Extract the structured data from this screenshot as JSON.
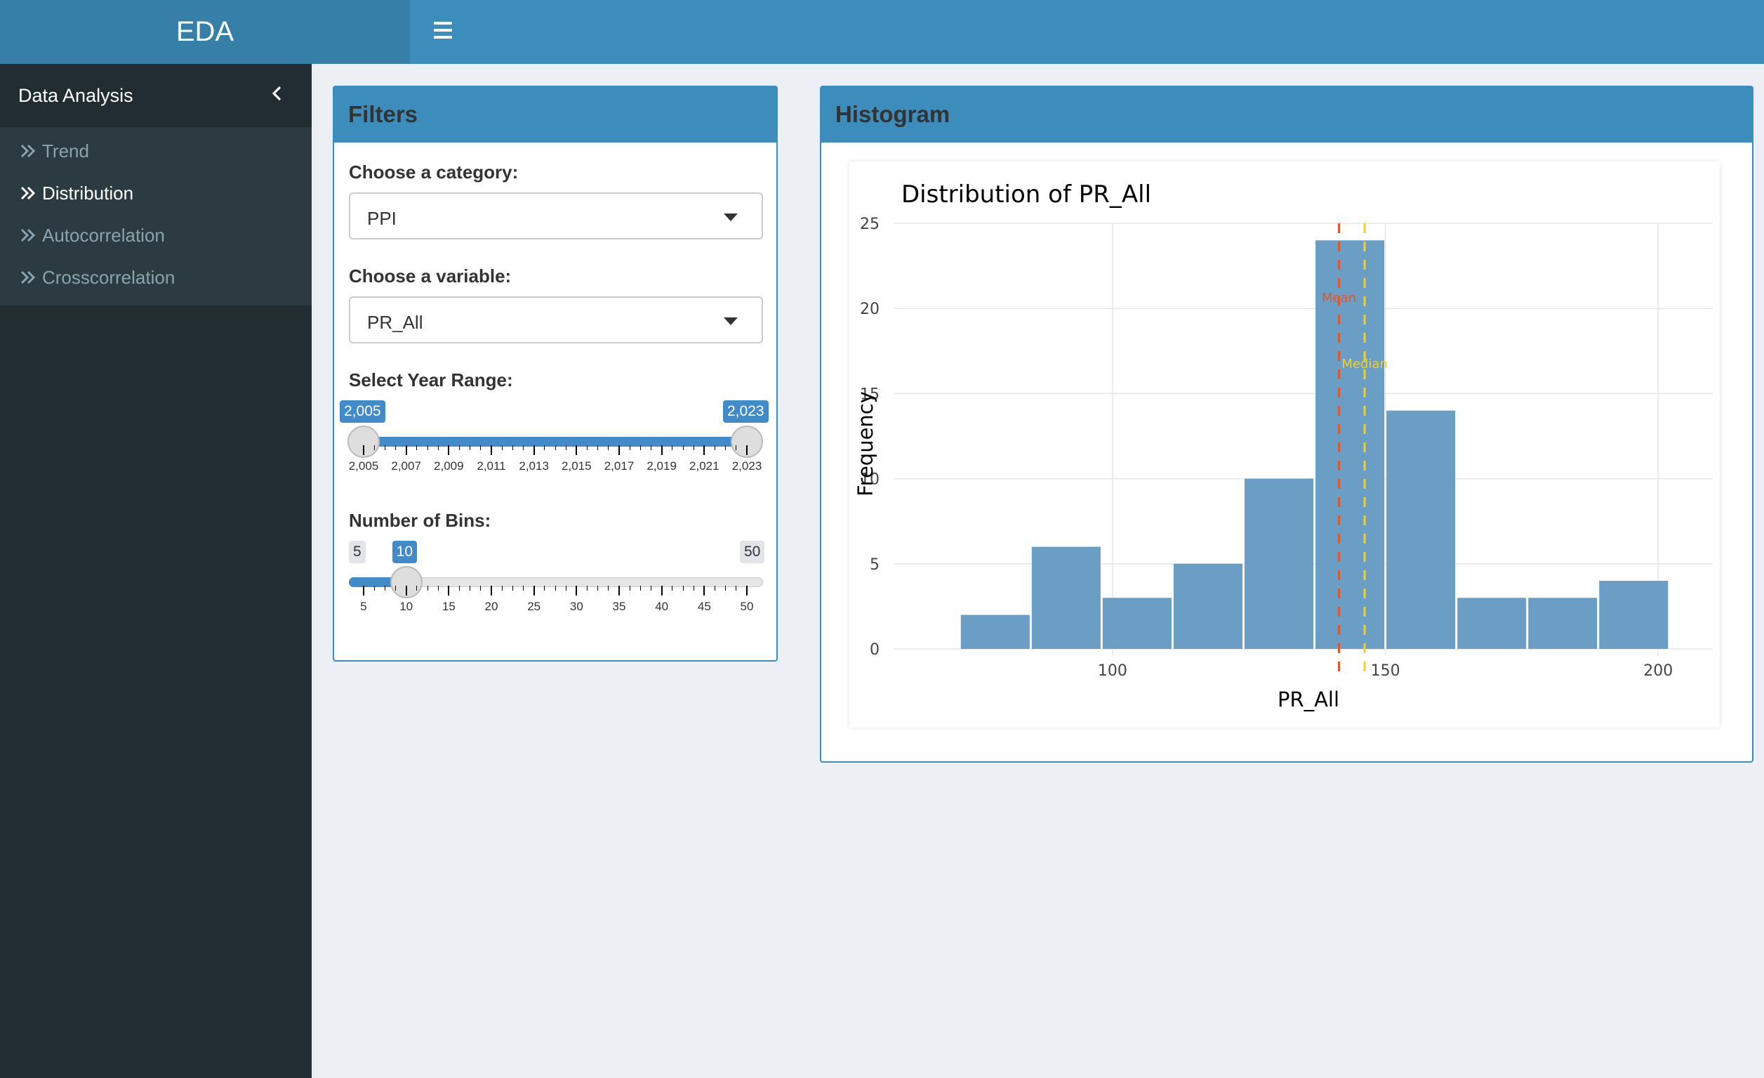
{
  "app": {
    "logo": "EDA"
  },
  "sidebar": {
    "header": "Data Analysis",
    "items": [
      {
        "label": "Trend",
        "active": false
      },
      {
        "label": "Distribution",
        "active": true
      },
      {
        "label": "Autocorrelation",
        "active": false
      },
      {
        "label": "Crosscorrelation",
        "active": false
      }
    ]
  },
  "filters": {
    "title": "Filters",
    "category": {
      "label": "Choose a category:",
      "value": "PPI"
    },
    "variable": {
      "label": "Choose a variable:",
      "value": "PR_All"
    },
    "year_range": {
      "label": "Select Year Range:",
      "min": 2005,
      "max": 2023,
      "from_label": "2,005",
      "to_label": "2,023",
      "from": 2005,
      "to": 2023,
      "ticks": [
        "2,005",
        "2,007",
        "2,009",
        "2,011",
        "2,013",
        "2,015",
        "2,017",
        "2,019",
        "2,021",
        "2,023"
      ]
    },
    "bins": {
      "label": "Number of Bins:",
      "min": 5,
      "max": 50,
      "value": 10,
      "min_label": "5",
      "max_label": "50",
      "value_label": "10",
      "ticks": [
        "5",
        "10",
        "15",
        "20",
        "25",
        "30",
        "35",
        "40",
        "45",
        "50"
      ]
    }
  },
  "histogram": {
    "box_title": "Histogram"
  },
  "chart_data": {
    "type": "bar",
    "title": "Distribution of PR_All",
    "xlabel": "PR_All",
    "ylabel": "Frequency",
    "bins": [
      {
        "x0": 72,
        "x1": 85,
        "count": 2
      },
      {
        "x0": 85,
        "x1": 98,
        "count": 6
      },
      {
        "x0": 98,
        "x1": 111,
        "count": 3
      },
      {
        "x0": 111,
        "x1": 124,
        "count": 5
      },
      {
        "x0": 124,
        "x1": 137,
        "count": 10
      },
      {
        "x0": 137,
        "x1": 150,
        "count": 24
      },
      {
        "x0": 150,
        "x1": 163,
        "count": 14
      },
      {
        "x0": 163,
        "x1": 176,
        "count": 3
      },
      {
        "x0": 176,
        "x1": 189,
        "count": 3
      },
      {
        "x0": 189,
        "x1": 202,
        "count": 4
      }
    ],
    "xlim": [
      60,
      210
    ],
    "ylim": [
      0,
      25
    ],
    "xticks": [
      100,
      150,
      200
    ],
    "yticks": [
      0,
      5,
      10,
      15,
      20,
      25
    ],
    "bar_color": "#6a9ec4",
    "vlines": [
      {
        "label": "Mean",
        "x": 141.5,
        "color": "#e0582a"
      },
      {
        "label": "Median",
        "x": 146.2,
        "color": "#f3d023"
      }
    ],
    "grid": true
  }
}
